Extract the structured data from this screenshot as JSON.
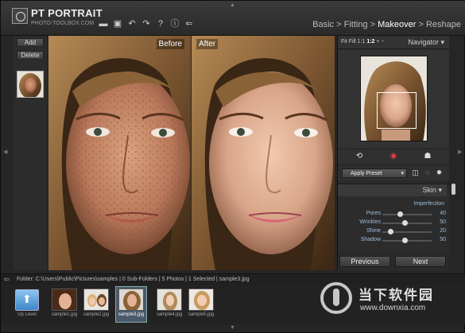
{
  "app": {
    "title": "PT PORTRAIT",
    "subtitle": "PHOTO-TOOLBOX.COM"
  },
  "toolbar": {
    "icons": [
      "open-icon",
      "save-icon",
      "undo-icon",
      "redo-icon",
      "help-icon",
      "info-icon",
      "exit-icon"
    ],
    "help_label": "?",
    "info_label": "ⓘ"
  },
  "breadcrumb": {
    "basic": "Basic",
    "fitting": "Fitting",
    "makeover": "Makeover",
    "reshape": "Reshape",
    "separator": " > "
  },
  "left_panel": {
    "add_label": "Add",
    "delete_label": "Delete"
  },
  "compare": {
    "before_label": "Before",
    "after_label": "After"
  },
  "navigator": {
    "zoom_fit": "Fit",
    "zoom_fill": "Fill",
    "zoom_1_1": "1:1",
    "zoom_1_2": "1:2",
    "zoom_plus": "+",
    "zoom_minus": "−",
    "title": "Navigator"
  },
  "preset": {
    "apply_label": "Apply Preset"
  },
  "skin": {
    "title": "Skin",
    "section": "Imperfection",
    "sliders": [
      {
        "label": "Pores",
        "value": 40
      },
      {
        "label": "Wrinkles",
        "value": 50
      },
      {
        "label": "Shine",
        "value": 20
      },
      {
        "label": "Shadow",
        "value": 50
      }
    ]
  },
  "nav_buttons": {
    "previous": "Previous",
    "next": "Next"
  },
  "folder": {
    "path_text": "Folder: C:\\Users\\Public\\Pictures\\samples  |  0 Sub-Folders  |  5 Photos  |  1 Selected  |  sample3.jpg"
  },
  "filmstrip": {
    "up_label": "Up Level",
    "files": [
      "sample1.jpg",
      "sample2.jpg",
      "sample3.jpg",
      "sample4.jpg",
      "sample5.jpg"
    ]
  },
  "watermark": {
    "cn": "当下软件园",
    "url": "www.downxia.com"
  },
  "colors": {
    "panel": "#262626",
    "header": "#333333",
    "accent_blue": "#3d86c9",
    "label_blue": "#9bbede"
  }
}
